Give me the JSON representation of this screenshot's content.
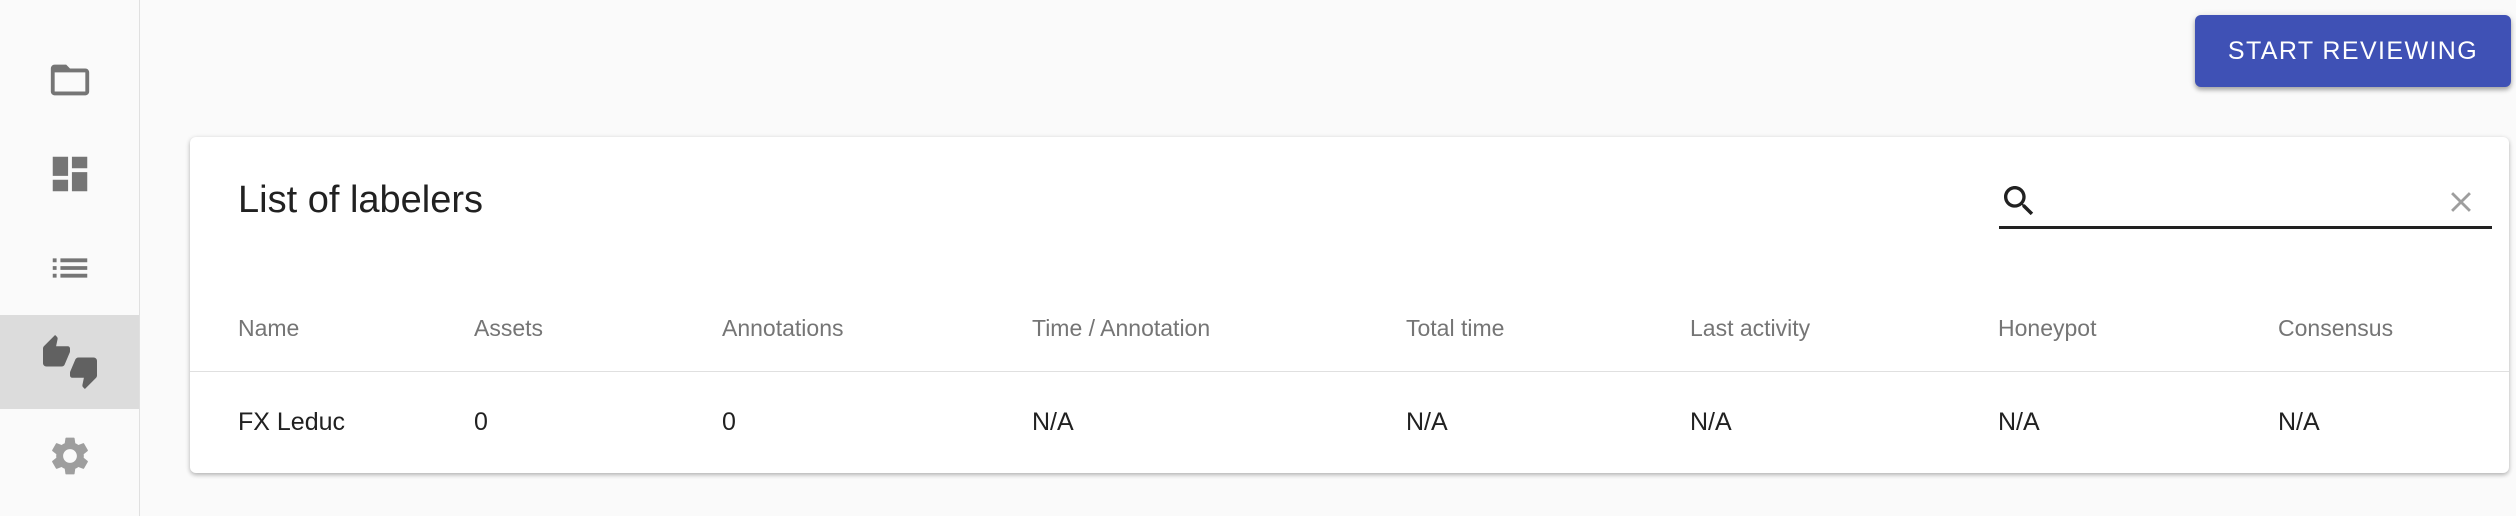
{
  "sidebar": {
    "items": [
      {
        "icon": "folder-icon",
        "active": false
      },
      {
        "icon": "dashboard-icon",
        "active": false
      },
      {
        "icon": "list-icon",
        "active": false
      },
      {
        "icon": "thumbs-up-down-icon",
        "active": true
      },
      {
        "icon": "gear-icon",
        "active": false
      }
    ]
  },
  "header": {
    "start_reviewing_label": "START REVIEWING"
  },
  "card": {
    "title": "List of labelers",
    "search": {
      "value": "",
      "placeholder": ""
    },
    "table": {
      "columns": [
        "Name",
        "Assets",
        "Annotations",
        "Time / Annotation",
        "Total time",
        "Last activity",
        "Honeypot",
        "Consensus"
      ],
      "rows": [
        [
          "FX Leduc",
          "0",
          "0",
          "N/A",
          "N/A",
          "N/A",
          "N/A",
          "N/A"
        ]
      ]
    }
  },
  "colors": {
    "primary": "#3f51b5",
    "sidebar_active": "#dcdcdc",
    "icon_gray": "#757575",
    "background": "#fafafa"
  }
}
